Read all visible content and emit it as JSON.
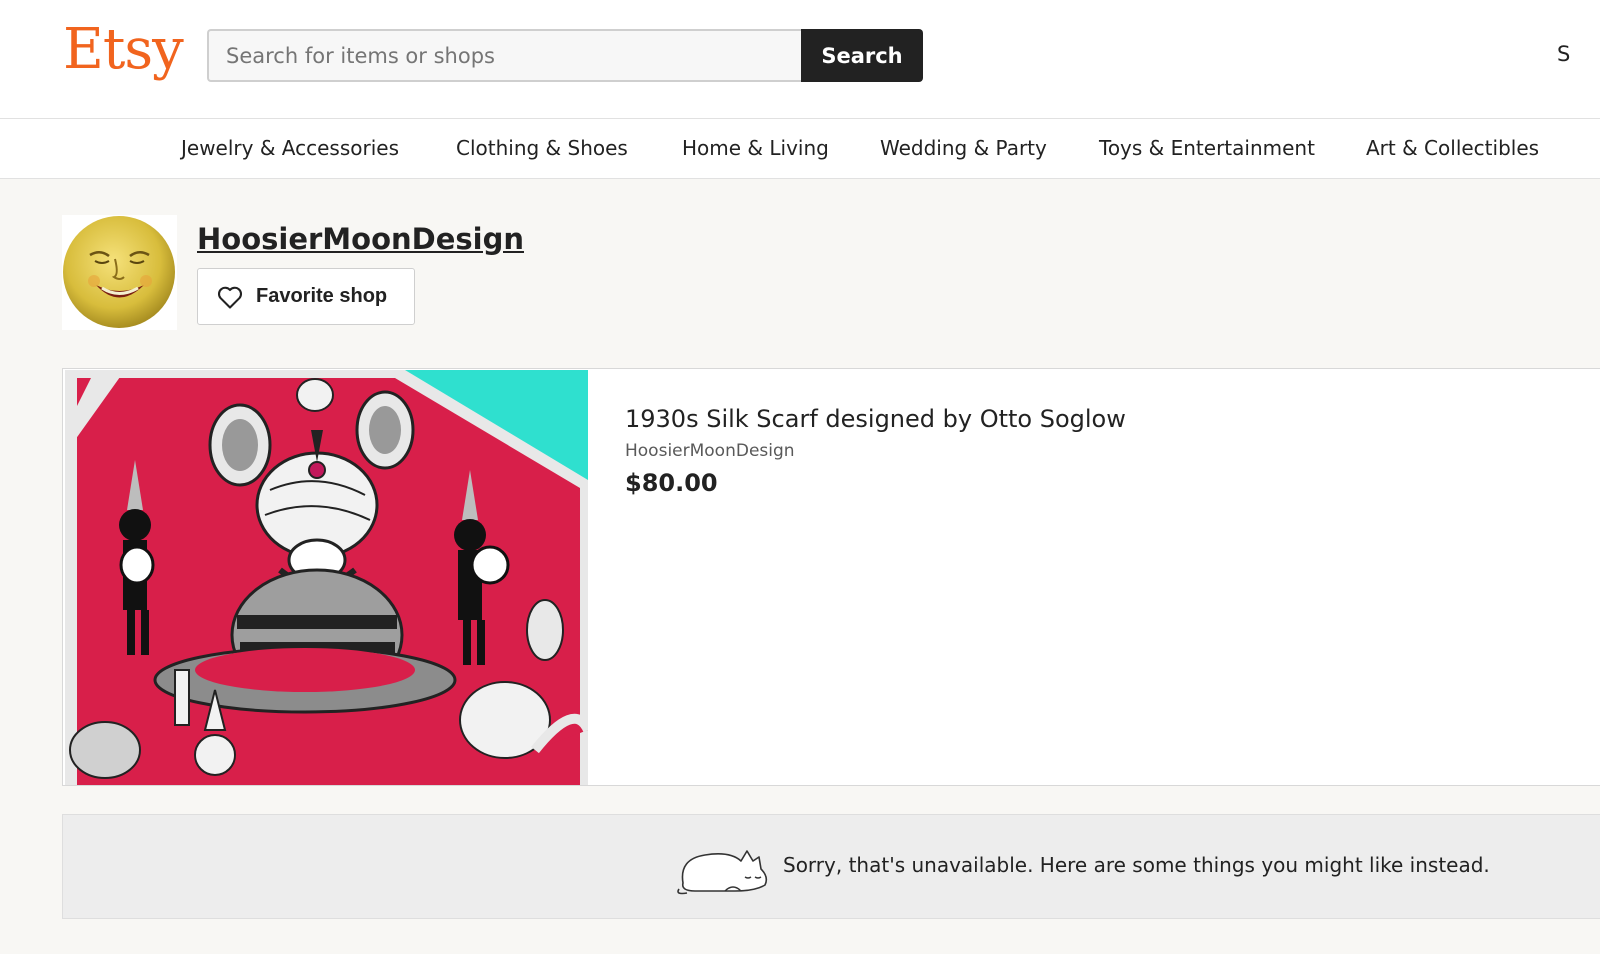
{
  "header": {
    "logo": "Etsy",
    "search_placeholder": "Search for items or shops",
    "search_button": "Search",
    "right_edge_text": "S"
  },
  "categories": [
    "Jewelry & Accessories",
    "Clothing & Shoes",
    "Home & Living",
    "Wedding & Party",
    "Toys & Entertainment",
    "Art & Collectibles"
  ],
  "shop": {
    "name": "HoosierMoonDesign",
    "favorite_label": "Favorite shop",
    "avatar_icon": "moon-face-avatar"
  },
  "listing": {
    "title": "1930s Silk Scarf designed by Otto Soglow",
    "shop_name": "HoosierMoonDesign",
    "price": "$80.00",
    "image_icon": "silk-scarf-photo"
  },
  "notice": {
    "text": "Sorry, that's unavailable. Here are some things you might like instead.",
    "icon": "sleeping-cat-icon"
  },
  "colors": {
    "brand": "#f1641e",
    "search_button_bg": "#222222",
    "scarf_red": "#d81f4a",
    "scarf_teal": "#2fe0cf"
  }
}
